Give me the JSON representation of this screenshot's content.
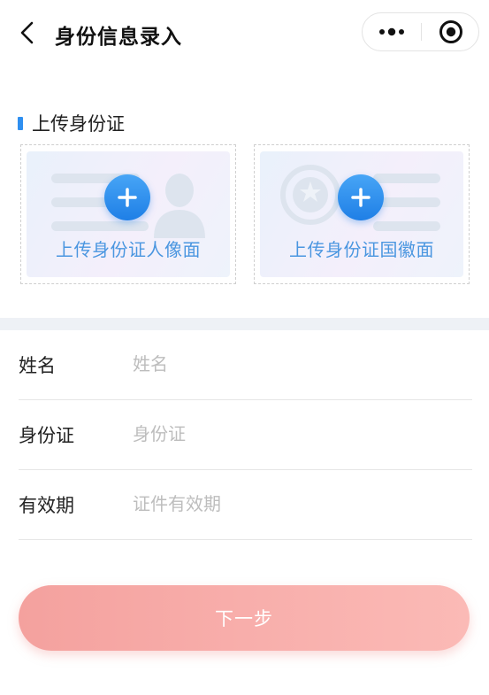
{
  "navbar": {
    "title": "身份信息录入",
    "back_icon": "chevron-left-icon",
    "more_icon": "more-dots-icon",
    "close_icon": "target-circle-icon"
  },
  "id_section": {
    "title": "上传身份证",
    "accent_color": "#2f8ff0",
    "portrait_upload_label": "上传身份证人像面",
    "emblem_upload_label": "上传身份证国徽面"
  },
  "form": {
    "fields": [
      {
        "label": "姓名",
        "placeholder": "姓名"
      },
      {
        "label": "身份证",
        "placeholder": "身份证"
      },
      {
        "label": "有效期",
        "placeholder": "证件有效期"
      }
    ]
  },
  "next_button": {
    "label": "下一步",
    "color": "#f8aeab"
  }
}
